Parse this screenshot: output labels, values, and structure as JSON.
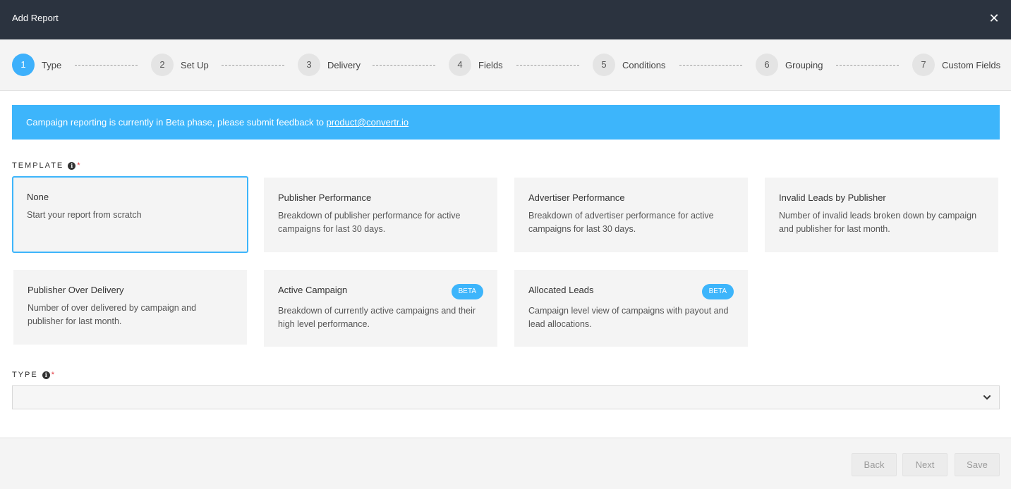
{
  "header": {
    "title": "Add Report",
    "close_icon": "close-icon"
  },
  "steps": [
    {
      "num": "1",
      "label": "Type"
    },
    {
      "num": "2",
      "label": "Set Up"
    },
    {
      "num": "3",
      "label": "Delivery"
    },
    {
      "num": "4",
      "label": "Fields"
    },
    {
      "num": "5",
      "label": "Conditions"
    },
    {
      "num": "6",
      "label": "Grouping"
    },
    {
      "num": "7",
      "label": "Custom Fields"
    }
  ],
  "active_step": "1",
  "banner": {
    "text": "Campaign reporting is currently in Beta phase, please submit feedback to ",
    "link": "product@convertr.io"
  },
  "template": {
    "label": "TEMPLATE",
    "required_mark": "*",
    "cards": [
      {
        "title": "None",
        "desc": "Start your report from scratch",
        "badge": ""
      },
      {
        "title": "Publisher Performance",
        "desc": "Breakdown of publisher performance for active campaigns for last 30 days.",
        "badge": ""
      },
      {
        "title": "Advertiser Performance",
        "desc": "Breakdown of advertiser performance for active campaigns for last 30 days.",
        "badge": ""
      },
      {
        "title": "Invalid Leads by Publisher",
        "desc": "Number of invalid leads broken down by campaign and publisher for last month.",
        "badge": ""
      },
      {
        "title": "Publisher Over Delivery",
        "desc": "Number of over delivered by campaign and publisher for last month.",
        "badge": ""
      },
      {
        "title": "Active Campaign",
        "desc": "Breakdown of currently active campaigns and their high level performance.",
        "badge": "BETA"
      },
      {
        "title": "Allocated Leads",
        "desc": "Campaign level view of campaigns with payout and lead allocations.",
        "badge": "BETA"
      }
    ],
    "selected": "None"
  },
  "type": {
    "label": "TYPE",
    "required_mark": "*",
    "value": ""
  },
  "footer": {
    "back": "Back",
    "next": "Next",
    "save": "Save"
  },
  "colors": {
    "accent": "#3db5fb",
    "header_bg": "#2b333f",
    "required": "#e0343a"
  }
}
